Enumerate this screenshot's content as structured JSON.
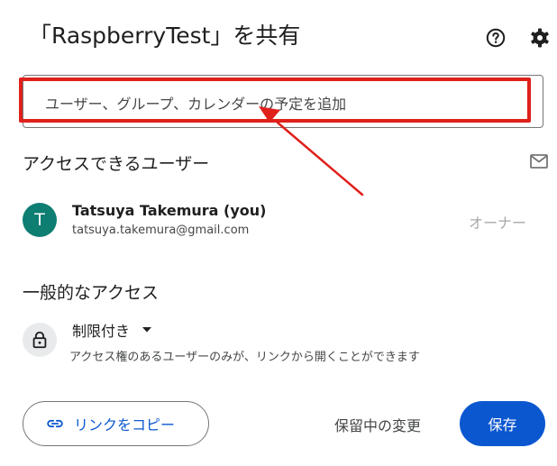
{
  "dialog": {
    "title": "「RaspberryTest」を共有",
    "help_icon": "help-circle-icon",
    "settings_icon": "gear-icon"
  },
  "share_input": {
    "placeholder": "ユーザー、グループ、カレンダーの予定を追加"
  },
  "annotation": {
    "highlight_color": "#e0201b"
  },
  "people_section": {
    "heading": "アクセスできるユーザー",
    "mail_icon": "mail-icon",
    "users": [
      {
        "initial": "T",
        "name": "Tatsuya Takemura (you)",
        "email": "tatsuya.takemura@gmail.com",
        "role": "オーナー",
        "avatar_color": "#0e7d72"
      }
    ]
  },
  "general_access": {
    "heading": "一般的なアクセス",
    "icon": "lock-icon",
    "selected": "制限付き",
    "description": "アクセス権のあるユーザーのみが、リンクから開くことができます"
  },
  "footer": {
    "copy_link_label": "リンクをコピー",
    "pending_label": "保留中の変更",
    "save_label": "保存"
  },
  "colors": {
    "accent": "#0b57d0",
    "text": "#1f1f1f",
    "muted": "#444746"
  }
}
